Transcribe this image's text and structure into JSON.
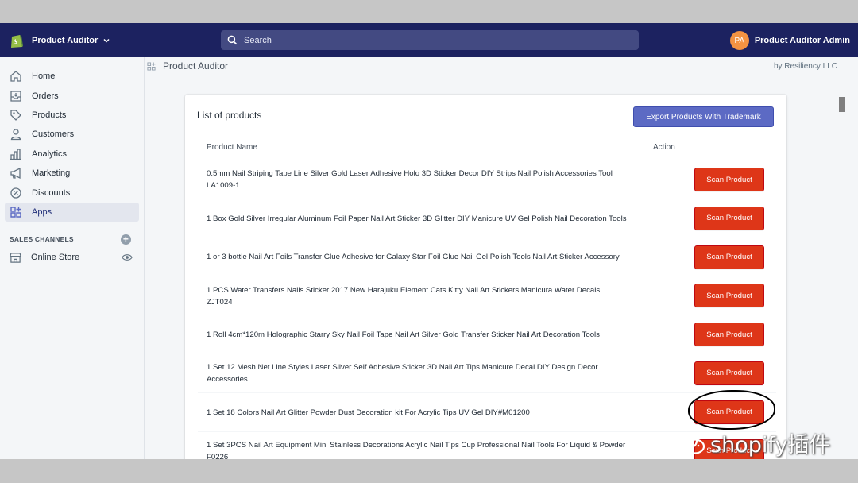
{
  "colors": {
    "topbar": "#1c2260",
    "search_bg": "#434a82",
    "primary_button": "#5c6ac4",
    "destructive_button": "#de3618",
    "avatar": "#f49342"
  },
  "topbar": {
    "store_name": "Product Auditor",
    "search_placeholder": "Search",
    "avatar_initials": "PA",
    "account_name": "Product Auditor Admin"
  },
  "sidebar": {
    "items": [
      {
        "label": "Home",
        "icon": "home-icon"
      },
      {
        "label": "Orders",
        "icon": "orders-icon"
      },
      {
        "label": "Products",
        "icon": "tag-icon"
      },
      {
        "label": "Customers",
        "icon": "person-icon"
      },
      {
        "label": "Analytics",
        "icon": "bar-chart-icon"
      },
      {
        "label": "Marketing",
        "icon": "megaphone-icon"
      },
      {
        "label": "Discounts",
        "icon": "discount-icon"
      },
      {
        "label": "Apps",
        "icon": "apps-icon",
        "active": true
      }
    ],
    "sales_channels_heading": "SALES CHANNELS",
    "online_store": "Online Store"
  },
  "page": {
    "breadcrumb": "Product Auditor",
    "byline": "by Resiliency LLC"
  },
  "card": {
    "title": "List of products",
    "export_button": "Export Products With Trademark",
    "columns": [
      "Product Name",
      "Action"
    ],
    "rows": [
      {
        "name": "0.5mm Nail Striping Tape Line Silver Gold Laser Adhesive Holo 3D Sticker Decor DIY Strips Nail Polish Accessories Tool LA1009-1",
        "action": "Scan Product"
      },
      {
        "name": "1 Box Gold Silver Irregular Aluminum Foil Paper Nail Art Sticker 3D Glitter DIY Manicure UV Gel Polish Nail Decoration Tools",
        "action": "Scan Product"
      },
      {
        "name": "1 or 3 bottle Nail Art Foils Transfer Glue Adhesive for Galaxy Star Foil Glue Nail Gel Polish Tools Nail Art Sticker Accessory",
        "action": "Scan Product"
      },
      {
        "name": "1 PCS Water Transfers Nails Sticker 2017 New Harajuku Element Cats Kitty Nail Art Stickers Manicura Water Decals ZJT024",
        "action": "Scan Product"
      },
      {
        "name": "1 Roll 4cm*120m Holographic Starry Sky Nail Foil Tape Nail Art Silver Gold Transfer Sticker Nail Art Decoration Tools",
        "action": "Scan Product"
      },
      {
        "name": "1 Set 12 Mesh Net Line Styles Laser Silver Self Adhesive Sticker 3D Nail Art Tips Manicure Decal DIY Design Decor Accessories",
        "action": "Scan Product"
      },
      {
        "name": "1 Set 18 Colors Nail Art Glitter Powder Dust Decoration kit For Acrylic Tips UV Gel DIY#M01200",
        "action": "Scan Product"
      },
      {
        "name": "1 Set 3PCS Nail Art Equipment Mini Stainless Decorations Acrylic Nail Tips Cup Professional Nail Tools For Liquid & Powder F0226",
        "action": "Scan Product"
      }
    ]
  },
  "watermark": "shopify插件"
}
